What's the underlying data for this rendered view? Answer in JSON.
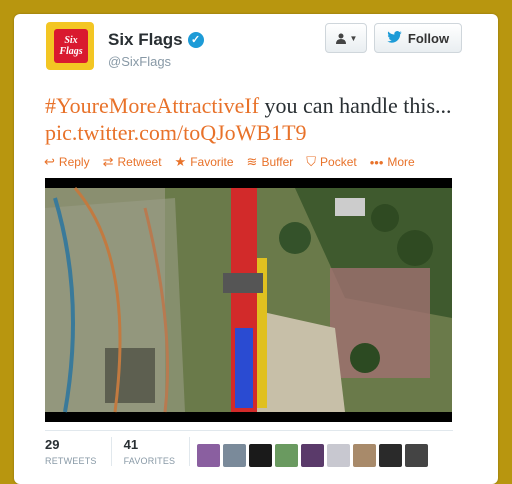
{
  "profile": {
    "name": "Six Flags",
    "handle": "@SixFlags",
    "logo_text_line1": "Six",
    "logo_text_line2": "Flags"
  },
  "follow_button": {
    "label": "Follow"
  },
  "tweet": {
    "hashtag": "#YoureMoreAttractiveIf",
    "text": " you can handle this... ",
    "link": "pic.twitter.com/toQJoWB1T9"
  },
  "actions": [
    {
      "label": "Reply",
      "icon": "reply-icon"
    },
    {
      "label": "Retweet",
      "icon": "retweet-icon"
    },
    {
      "label": "Favorite",
      "icon": "star-icon"
    },
    {
      "label": "Buffer",
      "icon": "buffer-icon"
    },
    {
      "label": "Pocket",
      "icon": "pocket-icon"
    },
    {
      "label": "More",
      "icon": "more-dots-icon"
    }
  ],
  "stats": {
    "retweets": {
      "count": "29",
      "label": "RETWEETS"
    },
    "favorites": {
      "count": "41",
      "label": "FAVORITES"
    }
  },
  "colors": {
    "background": "#b8960f",
    "accent": "#e8722a",
    "verified": "#1d9bd7"
  }
}
